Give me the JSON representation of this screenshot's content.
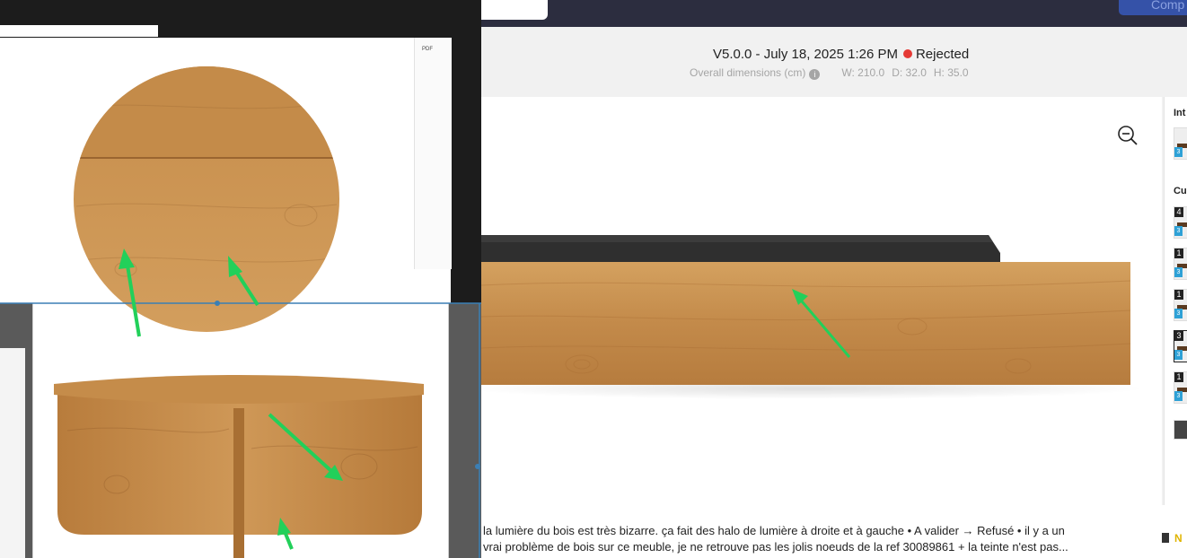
{
  "header": {
    "version_label": "V5.0.0 - July 18, 2025 1:26 PM",
    "status_label": "Rejected",
    "status_color": "#e53935",
    "dimensions_label": "Overall dimensions (cm)",
    "info_icon": "i",
    "width_label": "W: 210.0",
    "depth_label": "D: 32.0",
    "height_label": "H: 35.0"
  },
  "topbar": {
    "cta_label": "Comp"
  },
  "right_panel": {
    "section_1": "Int",
    "section_2": "Cu",
    "thumbs": [
      {
        "num": "",
        "cube": "3"
      },
      {
        "num": "4",
        "cube": "3"
      },
      {
        "num": "1",
        "cube": "3"
      },
      {
        "num": "1",
        "cube": "3"
      },
      {
        "num": "3",
        "cube": "3"
      },
      {
        "num": "1",
        "cube": "3"
      },
      {
        "num": "",
        "cube": ""
      }
    ]
  },
  "comment": {
    "line1": "la lumière du bois est très bizarre. ça fait des halo de lumière à droite et à gauche • A valider → Refusé • il y a un",
    "line2": "vrai problème de bois sur ce meuble, je ne retrouve pas les jolis noeuds de la ref 30089861 + la teinte n'est pas...",
    "author_initial": "N"
  },
  "overlay": {
    "pdf_label": "PDF"
  },
  "colors": {
    "topbar": "#2c2d3f",
    "wood": "#c8924f",
    "annotation_arrow": "#22d05a",
    "cube_badge": "#2ea1d6"
  },
  "icons": {
    "zoom": "zoom-out-icon",
    "info": "info-icon",
    "building": "building-icon"
  }
}
